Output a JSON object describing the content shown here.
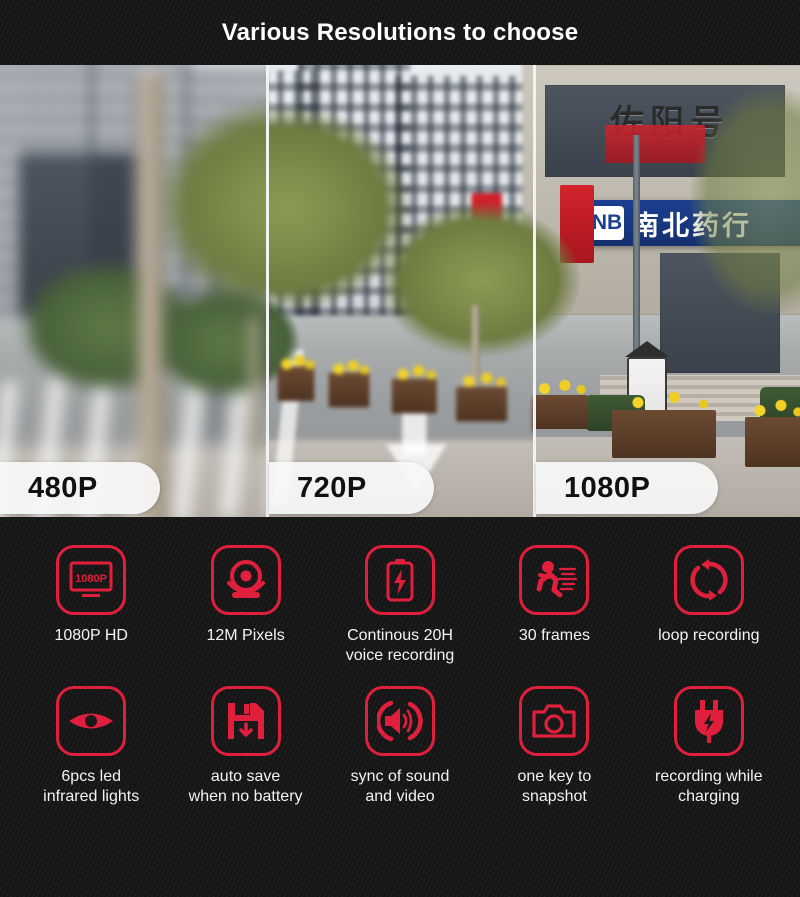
{
  "header": {
    "title": "Various Resolutions to choose"
  },
  "comparison": {
    "panels": [
      {
        "label": "480P",
        "quality": "low",
        "icon_name": "resolution-badge-480p"
      },
      {
        "label": "720P",
        "quality": "medium",
        "icon_name": "resolution-badge-720p"
      },
      {
        "label": "1080P",
        "quality": "high",
        "icon_name": "resolution-badge-1080p"
      }
    ],
    "scene": {
      "shop_sign_text": "南北药行",
      "shop_logo_text": "NB",
      "top_sign_text": "佐阳号"
    }
  },
  "features": {
    "row1": [
      {
        "label": "1080P HD",
        "icon_name": "monitor-1080p-icon",
        "screen_text": "1080P"
      },
      {
        "label": "12M Pixels",
        "icon_name": "webcam-icon"
      },
      {
        "label": "Continous 20H\nvoice recording",
        "icon_name": "battery-bolt-icon"
      },
      {
        "label": "30 frames",
        "icon_name": "running-person-icon"
      },
      {
        "label": "loop recording",
        "icon_name": "loop-arrows-icon"
      }
    ],
    "row2": [
      {
        "label": "6pcs led\ninfrared lights",
        "icon_name": "eye-icon"
      },
      {
        "label": "auto save\nwhen no battery",
        "icon_name": "floppy-save-icon"
      },
      {
        "label": "sync of sound\nand video",
        "icon_name": "speaker-sound-icon"
      },
      {
        "label": "one key to\nsnapshot",
        "icon_name": "camera-icon"
      },
      {
        "label": "recording while\ncharging",
        "icon_name": "power-plug-bolt-icon"
      }
    ]
  },
  "colors": {
    "accent_red": "#e01f3d",
    "background": "#151515",
    "text_light": "#f3f3f3",
    "badge_bg": "#f8f8f8",
    "sign_blue": "#1b3f8f"
  }
}
